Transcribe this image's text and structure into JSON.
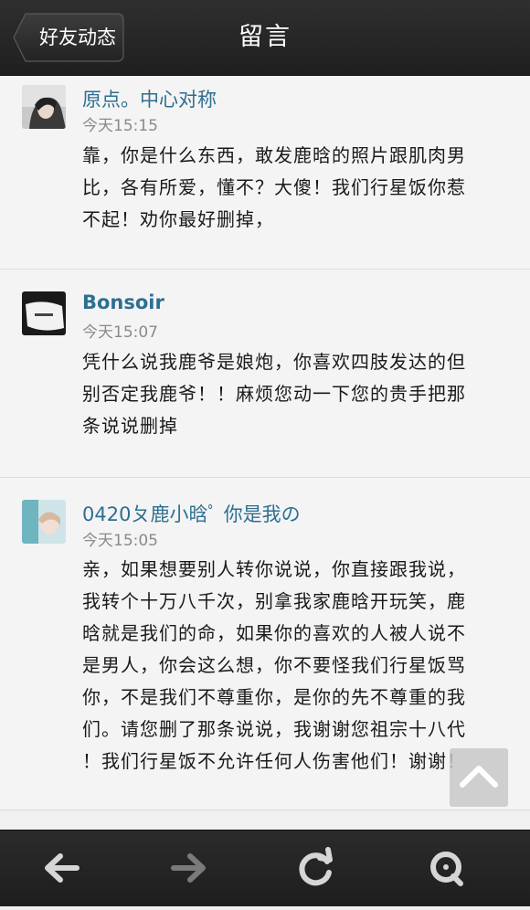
{
  "header": {
    "back_label": "好友动态",
    "title": "留言"
  },
  "comments": [
    {
      "author": "原点。中心对称",
      "time": "今天15:15",
      "lines": [
        "靠，你是什么东西，敢发鹿晗的照片跟肌肉男",
        "比，各有所爱，懂不？大傻！我们行星饭你惹",
        "不起！劝你最好删掉，"
      ]
    },
    {
      "author": "Bonsoir",
      "time": "今天15:07",
      "lines": [
        "凭什么说我鹿爷是娘炮，你喜欢四肢发达的但",
        "别否定我鹿爷！！麻烦您动一下您的贵手把那",
        "条说说删掉"
      ]
    },
    {
      "author": "0420ㄆ鹿小晗ﾟ 你是我の",
      "time": "今天15:05",
      "lines": [
        "亲，如果想要别人转你说说，你直接跟我说，",
        "我转个十万八千次，别拿我家鹿晗开玩笑，鹿",
        "晗就是我们的命，如果你的喜欢的人被人说不",
        "是男人，你会这么想，你不要怪我们行星饭骂",
        "你，不是我们不尊重你，是你的先不尊重的我",
        "们。请您删了那条说说，我谢谢您祖宗十八代",
        "！我们行星饭不允许任何人伤害他们！谢谢！"
      ]
    }
  ],
  "bottom_nav": {
    "back_icon": "arrow-left-icon",
    "forward_icon": "arrow-right-icon",
    "refresh_icon": "refresh-icon",
    "home_icon": "qq-home-icon"
  },
  "colors": {
    "author": "#2d6f91",
    "time": "#8a8a8a",
    "bar": "#262626",
    "card": "#f4f4f4"
  }
}
